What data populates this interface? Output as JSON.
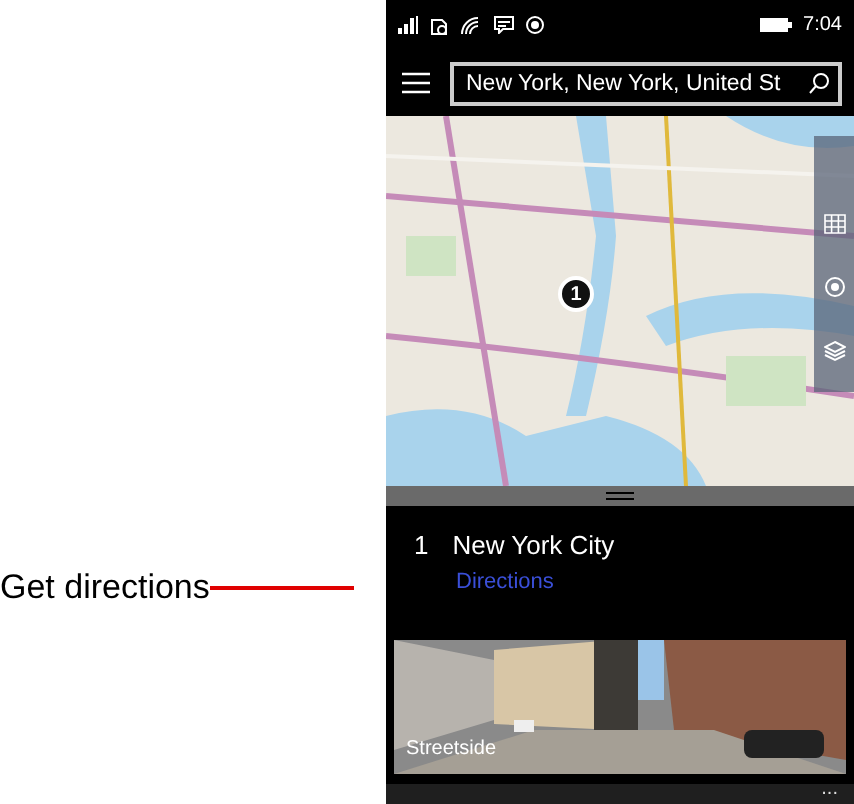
{
  "annotation": {
    "label": "Get directions"
  },
  "status_bar": {
    "time": "7:04"
  },
  "search": {
    "value": "New York, New York, United St"
  },
  "map": {
    "pin_label": "1"
  },
  "result": {
    "index": "1",
    "name": "New York City",
    "link": "Directions"
  },
  "streetside": {
    "label": "Streetside"
  },
  "app_bar": {
    "more": "..."
  }
}
